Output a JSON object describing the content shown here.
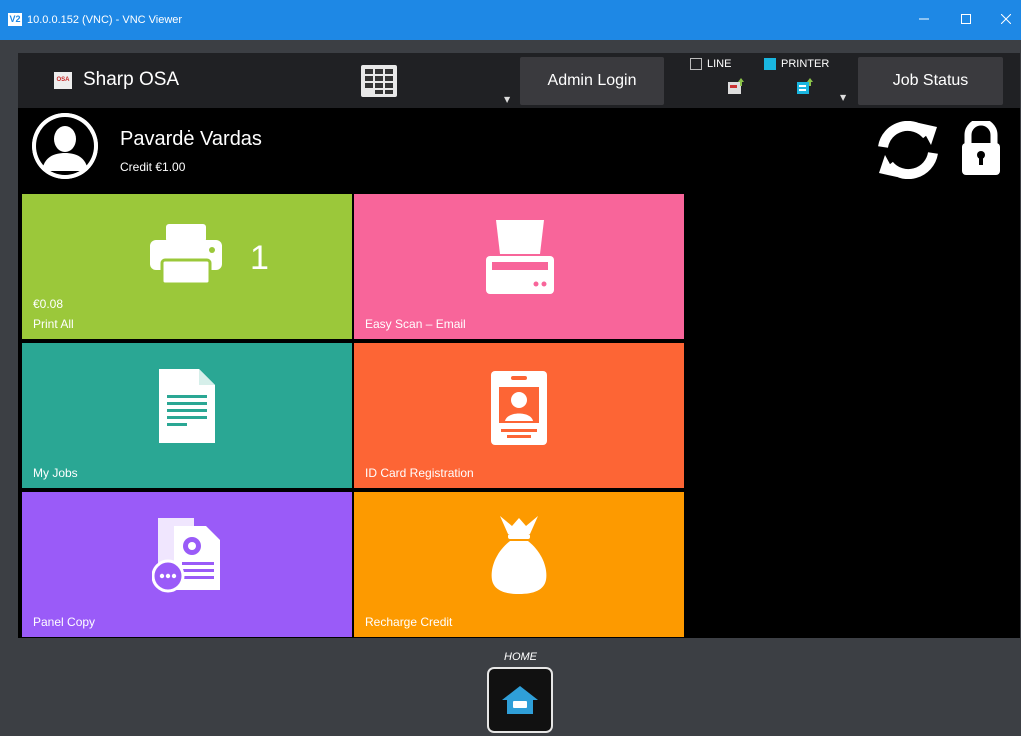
{
  "window": {
    "logo_text": "V2",
    "title": "10.0.0.152 (VNC) - VNC Viewer"
  },
  "topbar": {
    "app_logo_text": "OSA",
    "app_name": "Sharp OSA",
    "admin_login": "Admin Login",
    "job_status": "Job Status",
    "line_label": "LINE",
    "printer_label": "PRINTER",
    "line_checked": false,
    "printer_checked": true
  },
  "user": {
    "name": "Pavardė Vardas",
    "credit": "Credit €1.00"
  },
  "tiles": [
    {
      "label": "Print All",
      "price": "€0.08",
      "count": "1",
      "color": "#9bc83a",
      "icon": "printer-icon"
    },
    {
      "label": "Easy Scan – Email",
      "color": "#f8659a",
      "icon": "scanner-icon"
    },
    {
      "label": "My Jobs",
      "color": "#2aa794",
      "icon": "document-icon"
    },
    {
      "label": "ID Card Registration",
      "color": "#fd6535",
      "icon": "id-card-icon"
    },
    {
      "label": "Panel Copy",
      "color": "#9a5bf8",
      "icon": "panel-copy-icon"
    },
    {
      "label": "Recharge Credit",
      "color": "#fd9a00",
      "icon": "money-bag-icon"
    }
  ],
  "bottom": {
    "home_label": "HOME"
  },
  "colors": {
    "titlebar": "#1e88e5",
    "frame": "#3c3f44",
    "accent_checkbox": "#19b6e0"
  }
}
